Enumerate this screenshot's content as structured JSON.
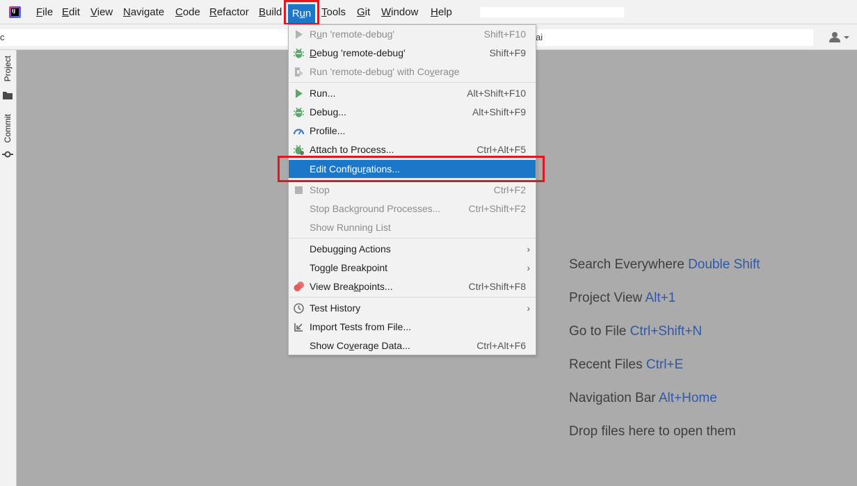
{
  "menubar": {
    "items": [
      {
        "name": "file",
        "pre": "",
        "mn": "F",
        "post": "ile"
      },
      {
        "name": "edit",
        "pre": "",
        "mn": "E",
        "post": "dit"
      },
      {
        "name": "view",
        "pre": "",
        "mn": "V",
        "post": "iew"
      },
      {
        "name": "navigate",
        "pre": "",
        "mn": "N",
        "post": "avigate"
      },
      {
        "name": "code",
        "pre": "",
        "mn": "C",
        "post": "ode"
      },
      {
        "name": "refactor",
        "pre": "",
        "mn": "R",
        "post": "efactor"
      },
      {
        "name": "build",
        "pre": "",
        "mn": "B",
        "post": "uild"
      },
      {
        "name": "run",
        "pre": "R",
        "mn": "u",
        "post": "n"
      },
      {
        "name": "tools",
        "pre": "",
        "mn": "T",
        "post": "ools"
      },
      {
        "name": "git",
        "pre": "",
        "mn": "G",
        "post": "it"
      },
      {
        "name": "window",
        "pre": "",
        "mn": "W",
        "post": "indow"
      },
      {
        "name": "help",
        "pre": "",
        "mn": "H",
        "post": "elp"
      }
    ]
  },
  "toolbar": {
    "left_field_text": "c",
    "right_field_text": "ai"
  },
  "left_strip": {
    "project_label": "Project",
    "commit_label": "Commit"
  },
  "run_menu": {
    "items": [
      {
        "id": "run-remote-debug",
        "pre": "R",
        "mn": "u",
        "post": "n 'remote-debug'",
        "shortcut": "Shift+F10",
        "disabled": true,
        "icon": "run-icon"
      },
      {
        "id": "debug-remote-debug",
        "pre": "",
        "mn": "D",
        "post": "ebug 'remote-debug'",
        "shortcut": "Shift+F9",
        "disabled": false,
        "icon": "debug-icon"
      },
      {
        "id": "run-with-coverage",
        "pre": "Run 'remote-debug' with Co",
        "mn": "v",
        "post": "erage",
        "shortcut": "",
        "disabled": true,
        "icon": "coverage-icon"
      },
      {
        "id": "run",
        "pre": "Run...",
        "mn": "",
        "post": "",
        "shortcut": "Alt+Shift+F10",
        "disabled": false,
        "icon": "run-icon"
      },
      {
        "id": "debug",
        "pre": "Debug...",
        "mn": "",
        "post": "",
        "shortcut": "Alt+Shift+F9",
        "disabled": false,
        "icon": "debug-icon"
      },
      {
        "id": "profile",
        "pre": "Profile...",
        "mn": "",
        "post": "",
        "shortcut": "",
        "disabled": false,
        "icon": "profile-icon"
      },
      {
        "id": "attach-to-process",
        "pre": "Attach to Process...",
        "mn": "",
        "post": "",
        "shortcut": "Ctrl+Alt+F5",
        "disabled": false,
        "icon": "attach-debugger-icon"
      },
      {
        "id": "edit-configurations",
        "pre": "Edit Configu",
        "mn": "r",
        "post": "ations...",
        "shortcut": "",
        "disabled": false,
        "icon": "",
        "selected": true
      },
      {
        "id": "stop",
        "pre": "Stop",
        "mn": "",
        "post": "",
        "shortcut": "Ctrl+F2",
        "disabled": true,
        "icon": "stop-icon"
      },
      {
        "id": "stop-background",
        "pre": "Stop Background Processes...",
        "mn": "",
        "post": "",
        "shortcut": "Ctrl+Shift+F2",
        "disabled": true,
        "icon": ""
      },
      {
        "id": "show-running-list",
        "pre": "Show Running List",
        "mn": "",
        "post": "",
        "shortcut": "",
        "disabled": true,
        "icon": ""
      },
      {
        "id": "debugging-actions",
        "pre": "Debugging Actions",
        "mn": "",
        "post": "",
        "shortcut": "",
        "disabled": false,
        "icon": "",
        "submenu": true
      },
      {
        "id": "toggle-breakpoint",
        "pre": "Toggle Breakpoint",
        "mn": "",
        "post": "",
        "shortcut": "",
        "disabled": false,
        "icon": "",
        "submenu": true
      },
      {
        "id": "view-breakpoints",
        "pre": "View Brea",
        "mn": "k",
        "post": "points...",
        "shortcut": "Ctrl+Shift+F8",
        "disabled": false,
        "icon": "breakpoints-icon"
      },
      {
        "id": "test-history",
        "pre": "Test History",
        "mn": "",
        "post": "",
        "shortcut": "",
        "disabled": false,
        "icon": "history-icon",
        "submenu": true
      },
      {
        "id": "import-tests",
        "pre": "Import Tests from File...",
        "mn": "",
        "post": "",
        "shortcut": "",
        "disabled": false,
        "icon": "import-icon"
      },
      {
        "id": "show-coverage-data",
        "pre": "Show Co",
        "mn": "v",
        "post": "erage Data...",
        "shortcut": "Ctrl+Alt+F6",
        "disabled": false,
        "icon": ""
      }
    ],
    "submenu_glyph": "›"
  },
  "hints": [
    {
      "text": "Search Everywhere ",
      "key": "Double Shift"
    },
    {
      "text": "Project View ",
      "key": "Alt+1"
    },
    {
      "text": "Go to File ",
      "key": "Ctrl+Shift+N"
    },
    {
      "text": "Recent Files ",
      "key": "Ctrl+E"
    },
    {
      "text": "Navigation Bar ",
      "key": "Alt+Home"
    },
    {
      "text": "Drop files here to open them",
      "key": ""
    }
  ],
  "colors": {
    "accent": "#1b78c8",
    "highlight_border": "#e3151f",
    "hint_key": "#2f58a8",
    "run_green": "#59a869",
    "breakpoint_red": "#e55b5b"
  }
}
